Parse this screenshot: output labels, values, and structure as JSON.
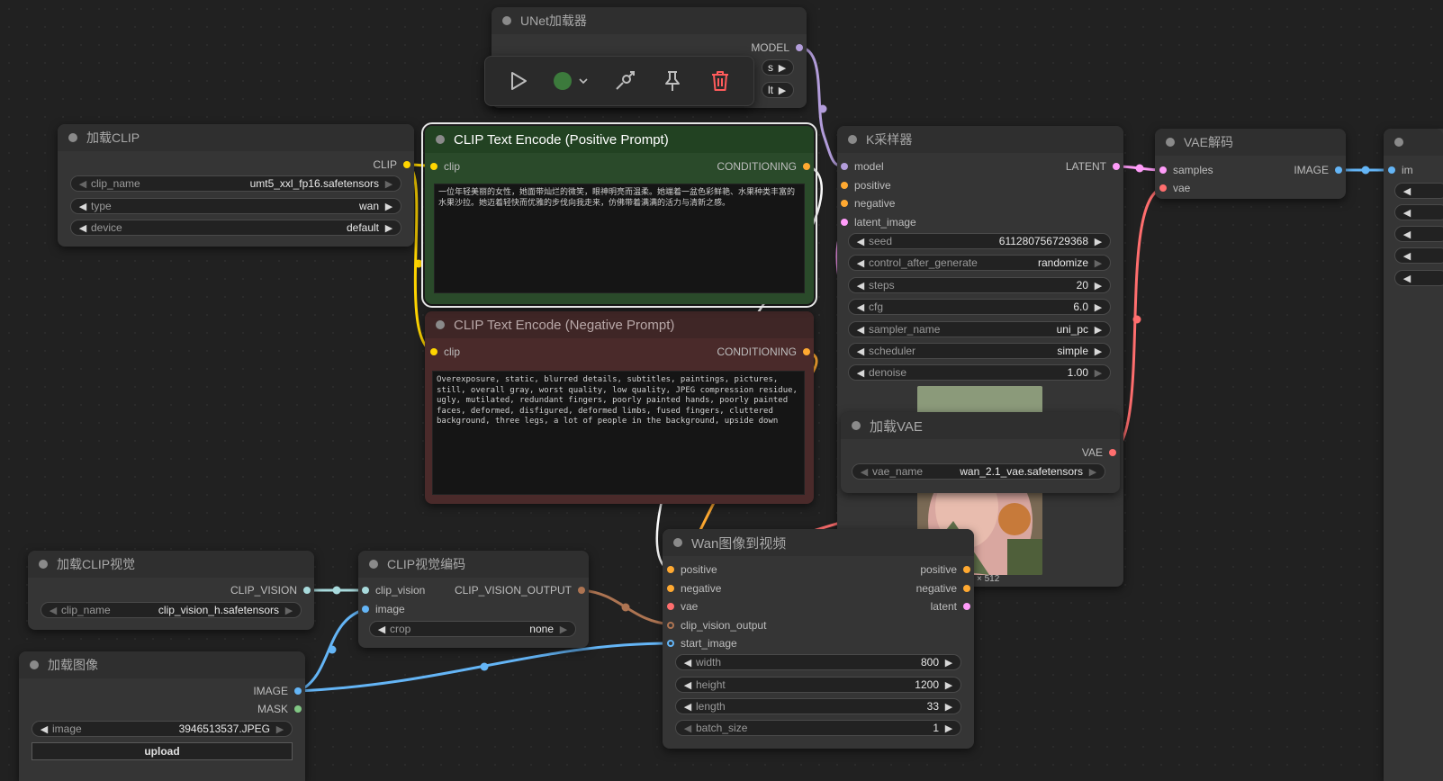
{
  "colors": {
    "clip": "#ffd500",
    "conditioning": "#ffa931",
    "model": "#b39ddb",
    "latent": "#ff9cf9",
    "vae": "#ff6e6e",
    "image": "#64b5f6",
    "clip_vision": "#a8dadc",
    "clip_vision_output": "#ad7452",
    "mask": "#81c784",
    "positive_bg": "#2a4a2a",
    "negative_bg": "#4a2a2a"
  },
  "toolbox": {
    "icons": [
      "play-icon",
      "color-dot-icon",
      "bypass-icon",
      "pin-icon",
      "trash-icon"
    ]
  },
  "unet": {
    "title": "UNet加载器",
    "output": "MODEL",
    "w1_value": "s",
    "w2_value": "lt"
  },
  "load_clip": {
    "title": "加载CLIP",
    "output": "CLIP",
    "widgets": [
      {
        "label": "clip_name",
        "value": "umt5_xxl_fp16.safetensors"
      },
      {
        "label": "type",
        "value": "wan"
      },
      {
        "label": "device",
        "value": "default"
      }
    ]
  },
  "positive": {
    "title": "CLIP Text Encode (Positive Prompt)",
    "input": "clip",
    "output": "CONDITIONING",
    "text": "一位年轻美丽的女性，她面带灿烂的微笑，眼神明亮而温柔。她端着一盆色彩鲜艳、水果种类丰富的水果沙拉。她迈着轻快而优雅的步伐向我走来，仿佛带着满满的活力与清新之感。"
  },
  "negative": {
    "title": "CLIP Text Encode (Negative Prompt)",
    "input": "clip",
    "output": "CONDITIONING",
    "text": "Overexposure, static, blurred details, subtitles, paintings, pictures, still, overall gray, worst quality, low quality, JPEG compression residue, ugly, mutilated, redundant fingers, poorly painted hands, poorly painted faces, deformed, disfigured, deformed limbs, fused fingers, cluttered background, three legs, a lot of people in the background, upside down"
  },
  "ksampler": {
    "title": "K采样器",
    "inputs": [
      "model",
      "positive",
      "negative",
      "latent_image"
    ],
    "output": "LATENT",
    "widgets": [
      {
        "label": "seed",
        "value": "611280756729368"
      },
      {
        "label": "control_after_generate",
        "value": "randomize"
      },
      {
        "label": "steps",
        "value": "20"
      },
      {
        "label": "cfg",
        "value": "6.0"
      },
      {
        "label": "sampler_name",
        "value": "uni_pc"
      },
      {
        "label": "scheduler",
        "value": "simple"
      },
      {
        "label": "denoise",
        "value": "1.00"
      }
    ],
    "size_label": "× 512"
  },
  "load_vae": {
    "title": "加载VAE",
    "output": "VAE",
    "widget": {
      "label": "vae_name",
      "value": "wan_2.1_vae.safetensors"
    }
  },
  "vae_decode": {
    "title": "VAE解码",
    "inputs": [
      "samples",
      "vae"
    ],
    "output": "IMAGE"
  },
  "save_partial": {
    "input": "im"
  },
  "clip_vision_loader": {
    "title": "加载CLIP视觉",
    "output": "CLIP_VISION",
    "widget": {
      "label": "clip_name",
      "value": "clip_vision_h.safetensors"
    }
  },
  "clip_vision_encode": {
    "title": "CLIP视觉编码",
    "inputs": [
      "clip_vision",
      "image"
    ],
    "output": "CLIP_VISION_OUTPUT",
    "widget": {
      "label": "crop",
      "value": "none"
    }
  },
  "load_image": {
    "title": "加载图像",
    "outputs": [
      "IMAGE",
      "MASK"
    ],
    "widget": {
      "label": "image",
      "value": "3946513537.JPEG"
    },
    "upload": "upload"
  },
  "wan": {
    "title": "Wan图像到视频",
    "inputs": [
      "positive",
      "negative",
      "vae",
      "clip_vision_output",
      "start_image"
    ],
    "outputs": [
      "positive",
      "negative",
      "latent"
    ],
    "widgets": [
      {
        "label": "width",
        "value": "800"
      },
      {
        "label": "height",
        "value": "1200"
      },
      {
        "label": "length",
        "value": "33"
      },
      {
        "label": "batch_size",
        "value": "1"
      }
    ]
  }
}
